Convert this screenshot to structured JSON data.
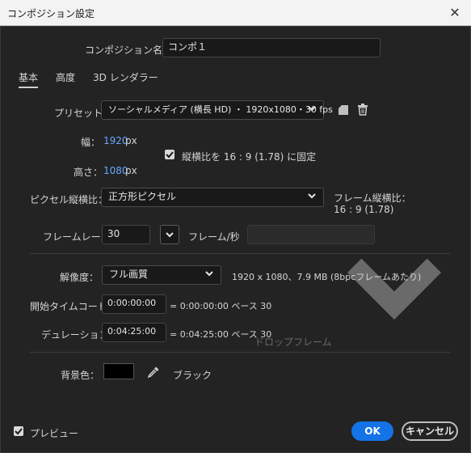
{
  "window": {
    "title": "コンポジション設定",
    "close_glyph": "✕"
  },
  "composition_name": {
    "label": "コンポジション名：",
    "value": "コンポ１"
  },
  "tabs": [
    {
      "label": "基本",
      "active": true
    },
    {
      "label": "高度",
      "active": false
    },
    {
      "label": "3D レンダラー",
      "active": false
    }
  ],
  "preset": {
    "label": "プリセット：",
    "value": "ソーシャルメディア (横長 HD) ・ 1920x1080・30 fps"
  },
  "width": {
    "label": "幅：",
    "value": "1920",
    "unit": "px"
  },
  "height": {
    "label": "高さ：",
    "value": "1080",
    "unit": "px"
  },
  "lock_aspect": {
    "label": "縦横比を 16 : 9 (1.78) に固定",
    "checked": true
  },
  "pixel_aspect": {
    "label": "ピクセル縦横比：",
    "value": "正方形ピクセル"
  },
  "frame_aspect": {
    "label": "フレーム縦横比：",
    "value": "16 : 9 (1.78)"
  },
  "frame_rate": {
    "label": "フレームレート：",
    "value": "30",
    "unit": "フレーム/秒",
    "drop_frame": "ドロップフレーム"
  },
  "resolution": {
    "label": "解像度：",
    "value": "フル画質",
    "info": "1920 x 1080、7.9 MB (8bpcフレームあたり)"
  },
  "start_timecode": {
    "label": "開始タイムコード：",
    "value": "0:00:00:00",
    "equals": "= 0:00:00:00 ベース 30"
  },
  "duration": {
    "label": "デュレーション：",
    "value": "0:04:25:00",
    "equals": "= 0:04:25:00 ベース 30"
  },
  "background": {
    "label": "背景色：",
    "color": "#000000",
    "name": "ブラック"
  },
  "preview": {
    "label": "プレビュー",
    "checked": true
  },
  "buttons": {
    "ok": "OK",
    "cancel": "キャンセル"
  },
  "colors": {
    "accent": "#1473e6",
    "link": "#6aa8ff",
    "background": "#232323"
  }
}
